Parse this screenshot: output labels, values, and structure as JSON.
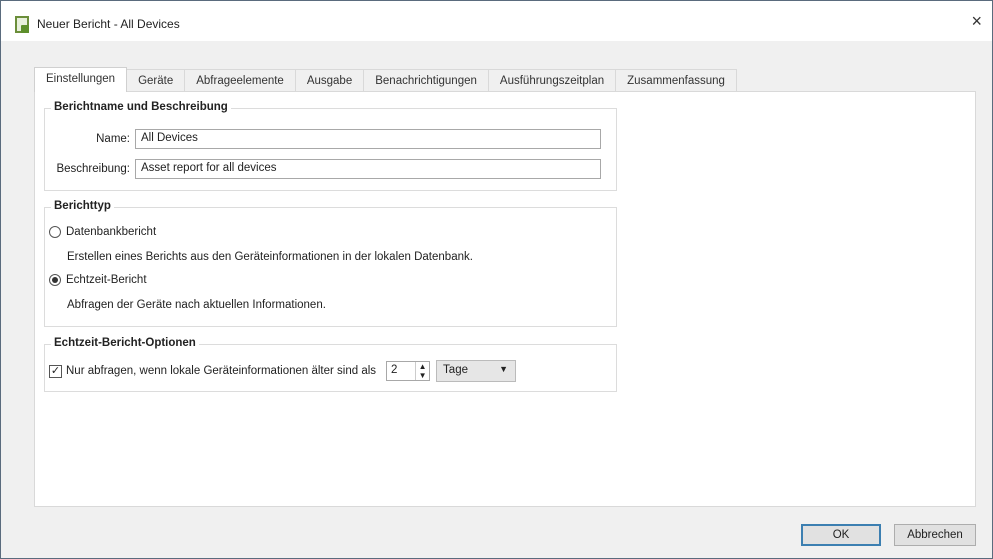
{
  "window": {
    "title": "Neuer Bericht - All Devices",
    "close_icon": "×"
  },
  "tabs": [
    "Einstellungen",
    "Geräte",
    "Abfrageelemente",
    "Ausgabe",
    "Benachrichtigungen",
    "Ausführungszeitplan",
    "Zusammenfassung"
  ],
  "group_name": {
    "title": "Berichtname und Beschreibung",
    "name_label": "Name:",
    "name_value": "All Devices",
    "desc_label": "Beschreibung:",
    "desc_value": "Asset report for all devices"
  },
  "group_type": {
    "title": "Berichttyp",
    "option1_label": "Datenbankbericht",
    "option1_desc": "Erstellen eines Berichts aus den Geräteinformationen in der lokalen Datenbank.",
    "option2_label": "Echtzeit-Bericht",
    "option2_desc": "Abfragen der Geräte nach aktuellen Informationen.",
    "selected": "Echtzeit-Bericht"
  },
  "group_options": {
    "title": "Echtzeit-Bericht-Optionen",
    "checkbox_label": "Nur abfragen, wenn lokale Geräteinformationen älter sind als",
    "checked": true,
    "spinner_value": "2",
    "unit_value": "Tage"
  },
  "buttons": {
    "ok": "OK",
    "cancel": "Abbrechen"
  }
}
